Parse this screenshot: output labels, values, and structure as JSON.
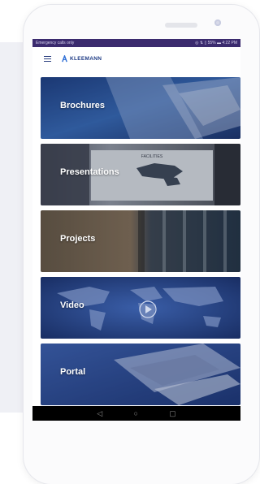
{
  "statusbar": {
    "left_text": "Emergency calls only",
    "right_text": "◎ ⇅ ▯ 55% ▬ 4:22 PM"
  },
  "app": {
    "brand_name": "KLEEMANN",
    "brand_color": "#1e3b85"
  },
  "tiles": [
    {
      "label": "Brochures"
    },
    {
      "label": "Presentations"
    },
    {
      "label": "Projects"
    },
    {
      "label": "Video"
    },
    {
      "label": "Portal"
    }
  ],
  "presentation_slide": {
    "title": "FACILITIES"
  },
  "navbar": {
    "back": "◁",
    "home": "○",
    "recents": "▢"
  }
}
